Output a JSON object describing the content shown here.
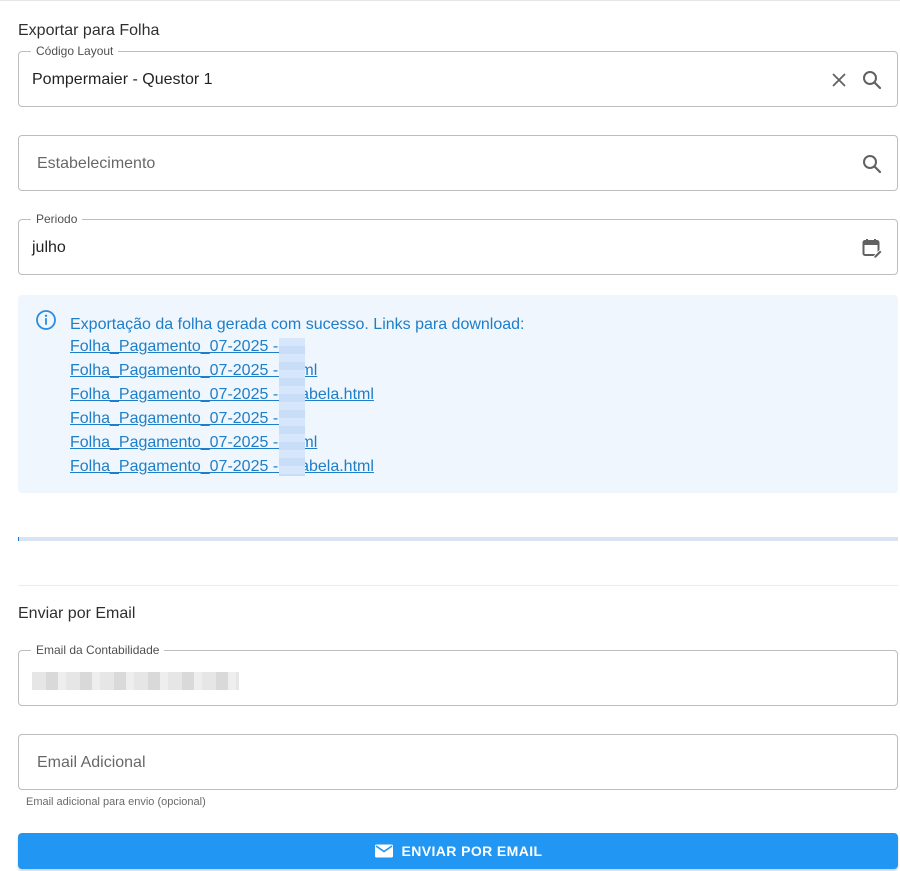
{
  "export_section": {
    "title": "Exportar para Folha",
    "layout_field": {
      "label": "Código Layout",
      "value": "Pompermaier - Questor  1"
    },
    "estabelecimento_field": {
      "placeholder": "Estabelecimento"
    },
    "periodo_field": {
      "label": "Periodo",
      "value": "julho"
    }
  },
  "alert": {
    "message": "Exportação da folha gerada com sucesso. Links para download:",
    "links": [
      "Folha_Pagamento_07-2025 -       .txt",
      "Folha_Pagamento_07-2025 -       .html",
      "Folha_Pagamento_07-2025 -       - Tabela.html",
      "Folha_Pagamento_07-2025 -       .txt",
      "Folha_Pagamento_07-2025 -       .html",
      "Folha_Pagamento_07-2025 -       - Tabela.html"
    ]
  },
  "progress": {
    "fraction": 0.001
  },
  "email_section": {
    "title": "Enviar por Email",
    "contabilidade_field": {
      "label": "Email da Contabilidade"
    },
    "adicional_field": {
      "placeholder": "Email Adicional",
      "helper": "Email adicional para envio (opcional)"
    },
    "send_button": {
      "label": "ENVIAR POR EMAIL",
      "icon": "mail-icon"
    }
  },
  "colors": {
    "primary": "#2196f3",
    "alert_bg": "#eff6fd",
    "alert_text": "#1e7ec8"
  }
}
